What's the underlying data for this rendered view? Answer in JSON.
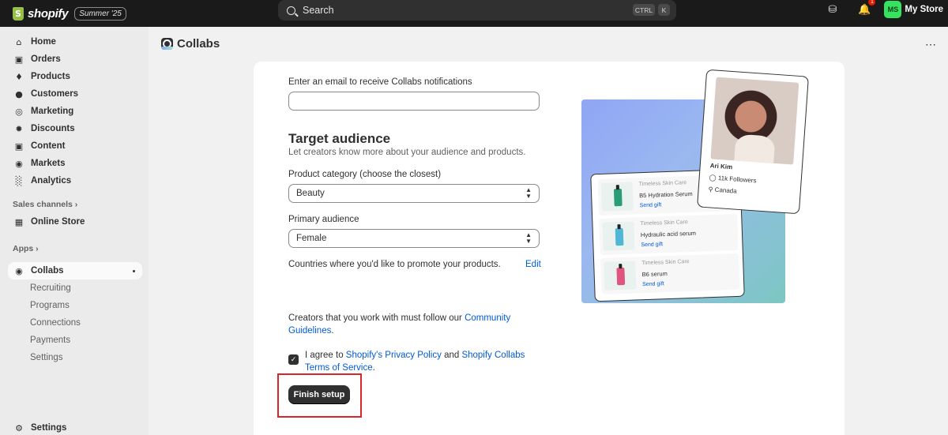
{
  "topbar": {
    "brand": "shopify",
    "edition": "Summer '25",
    "search_placeholder": "Search",
    "shortcut_ctrl": "CTRL",
    "shortcut_key": "K",
    "notification_count": "1",
    "avatar_initials": "MS",
    "store_name": "My Store"
  },
  "sidebar": {
    "items": [
      {
        "label": "Home",
        "icon": "home-icon"
      },
      {
        "label": "Orders",
        "icon": "orders-icon"
      },
      {
        "label": "Products",
        "icon": "tag-icon"
      },
      {
        "label": "Customers",
        "icon": "person-icon"
      },
      {
        "label": "Marketing",
        "icon": "target-icon"
      },
      {
        "label": "Discounts",
        "icon": "discount-icon"
      },
      {
        "label": "Content",
        "icon": "image-icon"
      },
      {
        "label": "Markets",
        "icon": "globe-icon"
      },
      {
        "label": "Analytics",
        "icon": "bar-chart-icon"
      }
    ],
    "sales_channels_label": "Sales channels",
    "online_store_label": "Online Store",
    "apps_label": "Apps",
    "collabs_label": "Collabs",
    "collabs_sub": [
      "Recruiting",
      "Programs",
      "Connections",
      "Payments",
      "Settings"
    ],
    "settings_label": "Settings"
  },
  "page": {
    "title": "Collabs"
  },
  "form": {
    "email_label": "Enter an email to receive Collabs notifications",
    "email_value": "",
    "target_title": "Target audience",
    "target_subtitle": "Let creators know more about your audience and products.",
    "category_label": "Product category (choose the closest)",
    "category_value": "Beauty",
    "audience_label": "Primary audience",
    "audience_value": "Female",
    "countries_label": "Countries where you'd like to promote your products.",
    "edit_label": "Edit",
    "guidelines_prefix": "Creators that you work with must follow our ",
    "guidelines_link": "Community Guidelines",
    "guidelines_suffix": ".",
    "agree_prefix": "I agree to ",
    "privacy_link": "Shopify's Privacy Policy",
    "agree_and": " and ",
    "terms_link": "Shopify Collabs Terms of Service",
    "agree_suffix": ".",
    "agree_checked": true,
    "finish_button": "Finish setup"
  },
  "illustration": {
    "products": [
      {
        "brand": "Timeless Skin Care",
        "name": "B5 Hydration Serum",
        "action": "Send gift",
        "color": "#2a9d78"
      },
      {
        "brand": "Timeless Skin Care",
        "name": "Hydraulic acid serum",
        "action": "Send gift",
        "color": "#4fb6d6"
      },
      {
        "brand": "Timeless Skin Care",
        "name": "B6 serum",
        "action": "Send gift",
        "color": "#e0557f"
      }
    ],
    "creator_name": "Ari Kim",
    "creator_followers": "11k Followers",
    "creator_location": "Canada"
  },
  "colors": {
    "accent_link": "#005bd3",
    "primary_button": "#303030",
    "highlight_box": "#d9262c",
    "brand_green": "#95bf47"
  }
}
